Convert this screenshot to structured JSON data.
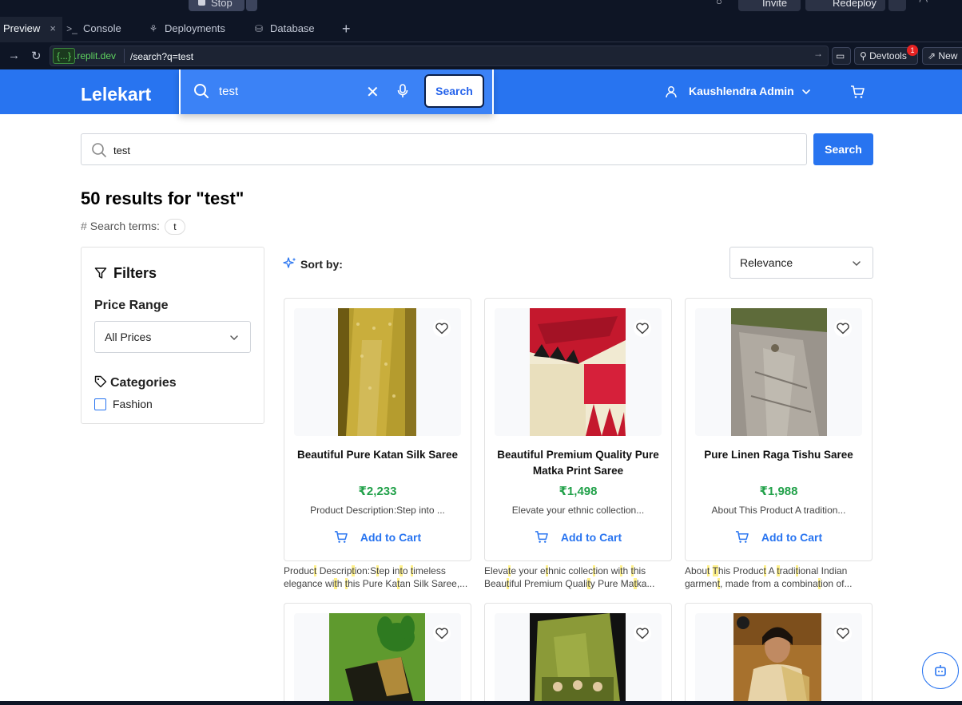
{
  "replit": {
    "stop_label": "Stop",
    "invite_label": "Invite",
    "redeploy_label": "Redeploy",
    "tabs": [
      {
        "label": "Preview",
        "icon": "close-icon"
      },
      {
        "label": "Console",
        "icon": "terminal-icon"
      },
      {
        "label": "Deployments",
        "icon": "deployments-icon"
      },
      {
        "label": "Database",
        "icon": "database-icon"
      }
    ],
    "url_badge": "{...}",
    "url_domain": ".replit.dev",
    "url_path": "/search?q=test",
    "devtools_label": "Devtools",
    "devtools_badge": "1",
    "new_tab_label": "New"
  },
  "header": {
    "logo": "Lelekart",
    "search_value": "test",
    "search_button": "Search",
    "user_name": "Kaushlendra Admin"
  },
  "search": {
    "value": "test",
    "button": "Search"
  },
  "results": {
    "title": "50 results for \"test\"",
    "terms_label": "Search terms:",
    "terms_chip": "t"
  },
  "filters": {
    "title": "Filters",
    "price_heading": "Price Range",
    "price_selected": "All Prices",
    "categories_heading": "Categories",
    "category_fashion": "Fashion"
  },
  "sort": {
    "label": "Sort by:",
    "selected": "Relevance"
  },
  "products": [
    {
      "title": "Beautiful Pure Katan Silk Saree",
      "price": "₹2,233",
      "desc": "Product Description:Step into ...",
      "add_to_cart": "Add to Cart"
    },
    {
      "title": "Beautiful Premium Quality Pure Matka Print Saree",
      "price": "₹1,498",
      "desc": "Elevate your ethnic collection...",
      "add_to_cart": "Add to Cart"
    },
    {
      "title": "Pure Linen Raga Tishu Saree",
      "price": "₹1,988",
      "desc": "About This Product A tradition...",
      "add_to_cart": "Add to Cart"
    }
  ],
  "colors": {
    "brand_blue": "#2874f0",
    "price_green": "#22a14a",
    "highlight": "#fef08a"
  }
}
